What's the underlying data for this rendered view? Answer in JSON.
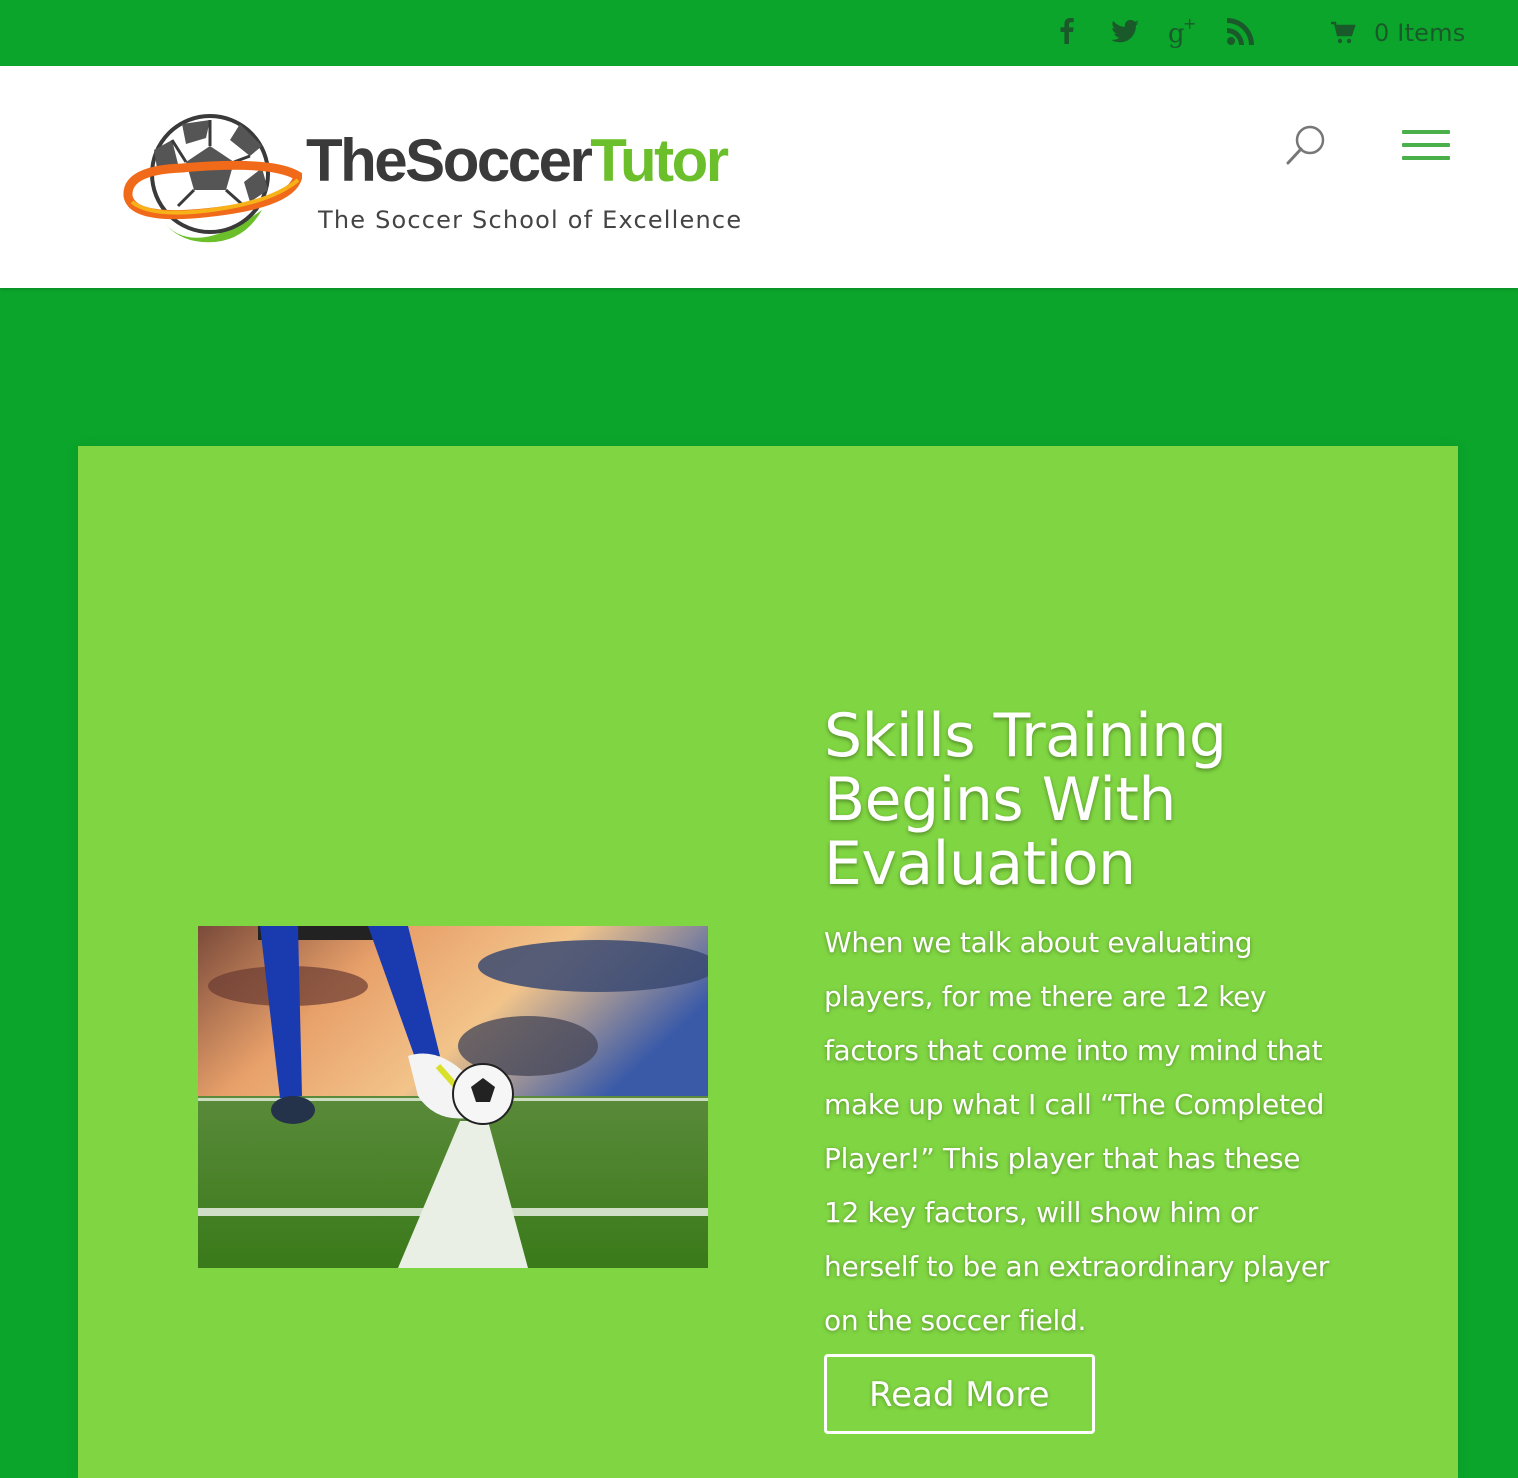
{
  "colors": {
    "topbar_bg": "#0ba52b",
    "header_bg": "#ffffff",
    "page_bg": "#0ba52b",
    "slide_bg": "#80d642",
    "icon_dark_green": "#1a5a2a",
    "accent_green": "#6abf2a"
  },
  "topbar": {
    "social_icons": [
      "facebook-icon",
      "twitter-icon",
      "google-plus-icon",
      "rss-icon"
    ],
    "cart_icon": "cart-icon",
    "cart_text": "0 Items"
  },
  "header": {
    "logo": {
      "title_dark": "TheSoccer",
      "title_green": "Tutor",
      "tagline": "The Soccer School of Excellence"
    },
    "search_icon": "search-icon",
    "menu_icon": "hamburger-menu-icon"
  },
  "slide": {
    "image_alt": "soccer-player-kicking-ball-image",
    "title": "Skills Training Begins With Evaluation",
    "text": "When we talk about evaluating players, for me there are 12 key factors that come into my mind that make up what I call “The Completed Player!”  This player that has these 12 key factors, will show him or herself to be an extraordinary player on the soccer field.",
    "button_label": "Read More"
  }
}
